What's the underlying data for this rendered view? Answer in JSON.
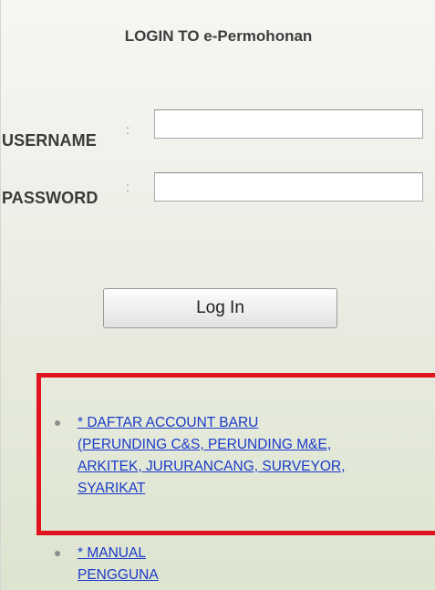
{
  "login": {
    "title": "LOGIN TO e-Permohonan",
    "username_label": "USERNAME",
    "password_label": "PASSWORD",
    "colon": ":",
    "username_value": "",
    "password_value": "",
    "button_label": "Log In"
  },
  "links": {
    "register_lines": [
      "* DAFTAR ACCOUNT BARU",
      "(PERUNDING C&S, PERUNDING M&E,",
      "ARKITEK, JURURANCANG, SURVEYOR,",
      "SYARIKAT"
    ],
    "manual": "* MANUAL PENGGUNA"
  },
  "colors": {
    "highlight_border": "#e0141e",
    "link": "#1b3ac9"
  }
}
